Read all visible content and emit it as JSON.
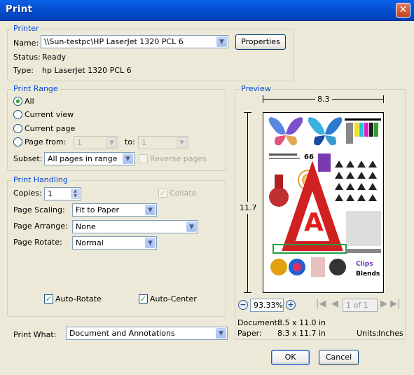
{
  "window": {
    "title": "Print",
    "close_glyph": "✕"
  },
  "printer": {
    "group_title": "Printer",
    "name_label": "Name:",
    "name_value": "\\\\Sun-testpc\\HP LaserJet 1320 PCL 6",
    "properties_label": "Properties",
    "status_label": "Status:",
    "status_value": "Ready",
    "type_label": "Type:",
    "type_value": "hp LaserJet 1320 PCL 6"
  },
  "print_range": {
    "group_title": "Print Range",
    "all": "All",
    "current_view": "Current view",
    "current_page": "Current page",
    "page_from": "Page from:",
    "from_value": "1",
    "to_label": "to:",
    "to_value": "1",
    "subset_label": "Subset:",
    "subset_value": "All pages in range",
    "reverse_pages": "Reverse pages",
    "selected": "all"
  },
  "print_handling": {
    "group_title": "Print Handling",
    "copies_label": "Copies:",
    "copies_value": "1",
    "collate": "Collate",
    "page_scaling_label": "Page Scaling:",
    "page_scaling_value": "Fit to Paper",
    "page_arrange_label": "Page Arrange:",
    "page_arrange_value": "None",
    "page_rotate_label": "Page Rotate:",
    "page_rotate_value": "Normal",
    "auto_rotate": "Auto-Rotate",
    "auto_center": "Auto-Center"
  },
  "print_what": {
    "label": "Print What:",
    "value": "Document and Annotations"
  },
  "preview": {
    "group_title": "Preview",
    "width_dim": "8.3",
    "height_dim": "11.7",
    "zoom_value": "93.33%",
    "page_field": "1 of 1",
    "document_label": "Document:",
    "document_value": "8.5 x 11.0 in",
    "paper_label": "Paper:",
    "paper_value": "8.3 x 11.7 in",
    "units_label": "Units:",
    "units_value": "Inches",
    "thumb_text": {
      "badge_66": "66",
      "clips": "Clips",
      "blends": "Blends",
      "a_letter": "A"
    }
  },
  "buttons": {
    "ok": "OK",
    "cancel": "Cancel"
  },
  "colors": {
    "title_bar": "#0552d4",
    "group_title": "#0046d5",
    "dialog_bg": "#ece9d8"
  }
}
